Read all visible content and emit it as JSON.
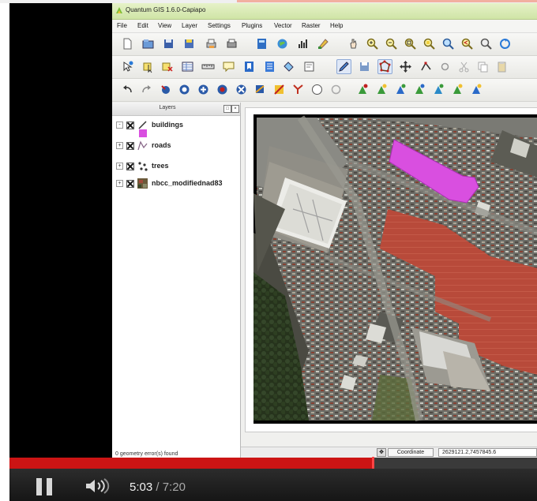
{
  "window": {
    "title": "Quantum GIS 1.6.0-Capiapo"
  },
  "menu": [
    "File",
    "Edit",
    "View",
    "Layer",
    "Settings",
    "Plugins",
    "Vector",
    "Raster",
    "Help"
  ],
  "layers_panel": {
    "title": "Layers",
    "layers": [
      {
        "name": "buildings",
        "icon": "polygon-layer-icon",
        "color": "#d94fe0"
      },
      {
        "name": "roads",
        "icon": "line-layer-icon"
      },
      {
        "name": "trees",
        "icon": "point-layer-icon"
      },
      {
        "name": "nbcc_modifiednad83",
        "icon": "raster-layer-icon"
      }
    ]
  },
  "status": {
    "message": "0 geometry error(s) found",
    "coordinate_label": "Coordinate",
    "coordinate_value": "2629121.2,7457845.6"
  },
  "player": {
    "current_time": "5:03",
    "separator": "/",
    "duration": "7:20",
    "progress": 0.689,
    "accent": "#cc1414"
  },
  "colors": {
    "buildings_fill": "#d94fe0",
    "titlebar": "#cfe4a6"
  }
}
